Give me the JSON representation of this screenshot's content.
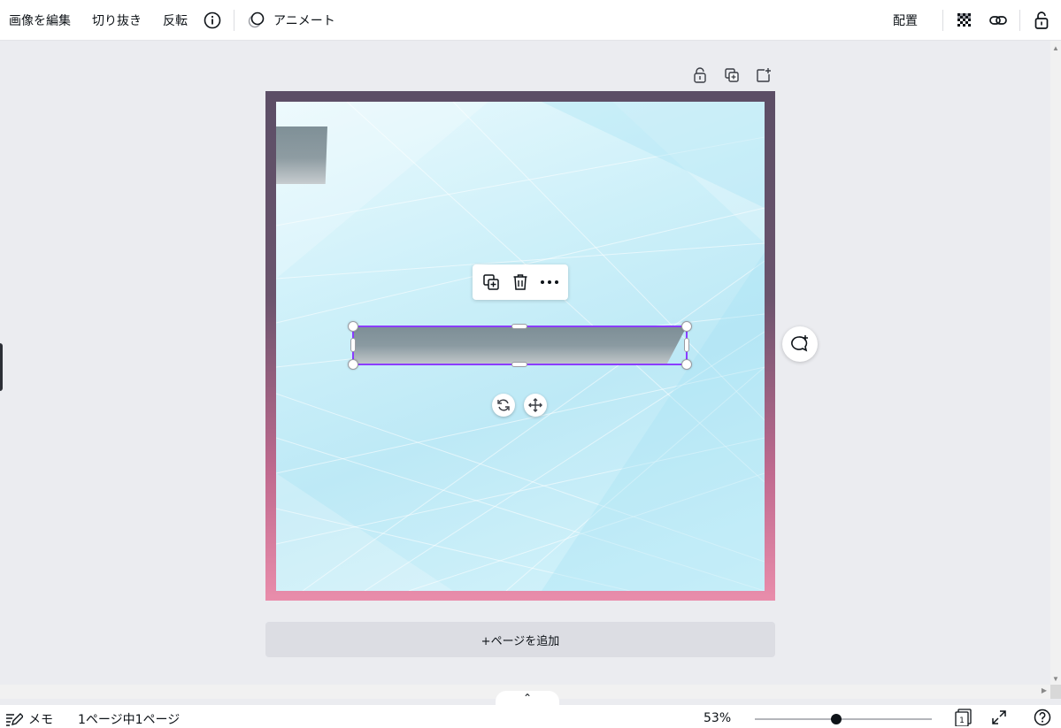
{
  "toolbar": {
    "edit_image": "画像を編集",
    "crop": "切り抜き",
    "flip": "反転",
    "animate": "アニメート",
    "position": "配置"
  },
  "canvas": {
    "add_page": "+ページを追加"
  },
  "bottom": {
    "memo": "メモ",
    "page_count": "1ページ中1ページ",
    "zoom": "53%",
    "zoom_level": 0.53,
    "page_thumb_number": "1"
  },
  "colors": {
    "selection": "#8b3dff",
    "frame_top": "#5c4e66",
    "frame_bottom": "#e98dab",
    "canvas_bg": "#cdf0f9"
  },
  "icons": {
    "info": "info-icon",
    "animate": "animate-icon",
    "transparency": "transparency-icon",
    "link": "link-icon",
    "lock": "lock-icon",
    "copy": "copy-icon",
    "delete": "trash-icon",
    "more": "more-icon",
    "rotate": "rotate-icon",
    "move": "move-icon",
    "comment": "comment-add-icon",
    "memo": "memo-icon",
    "pages": "pages-icon",
    "fullscreen": "fullscreen-icon",
    "help": "help-icon"
  }
}
